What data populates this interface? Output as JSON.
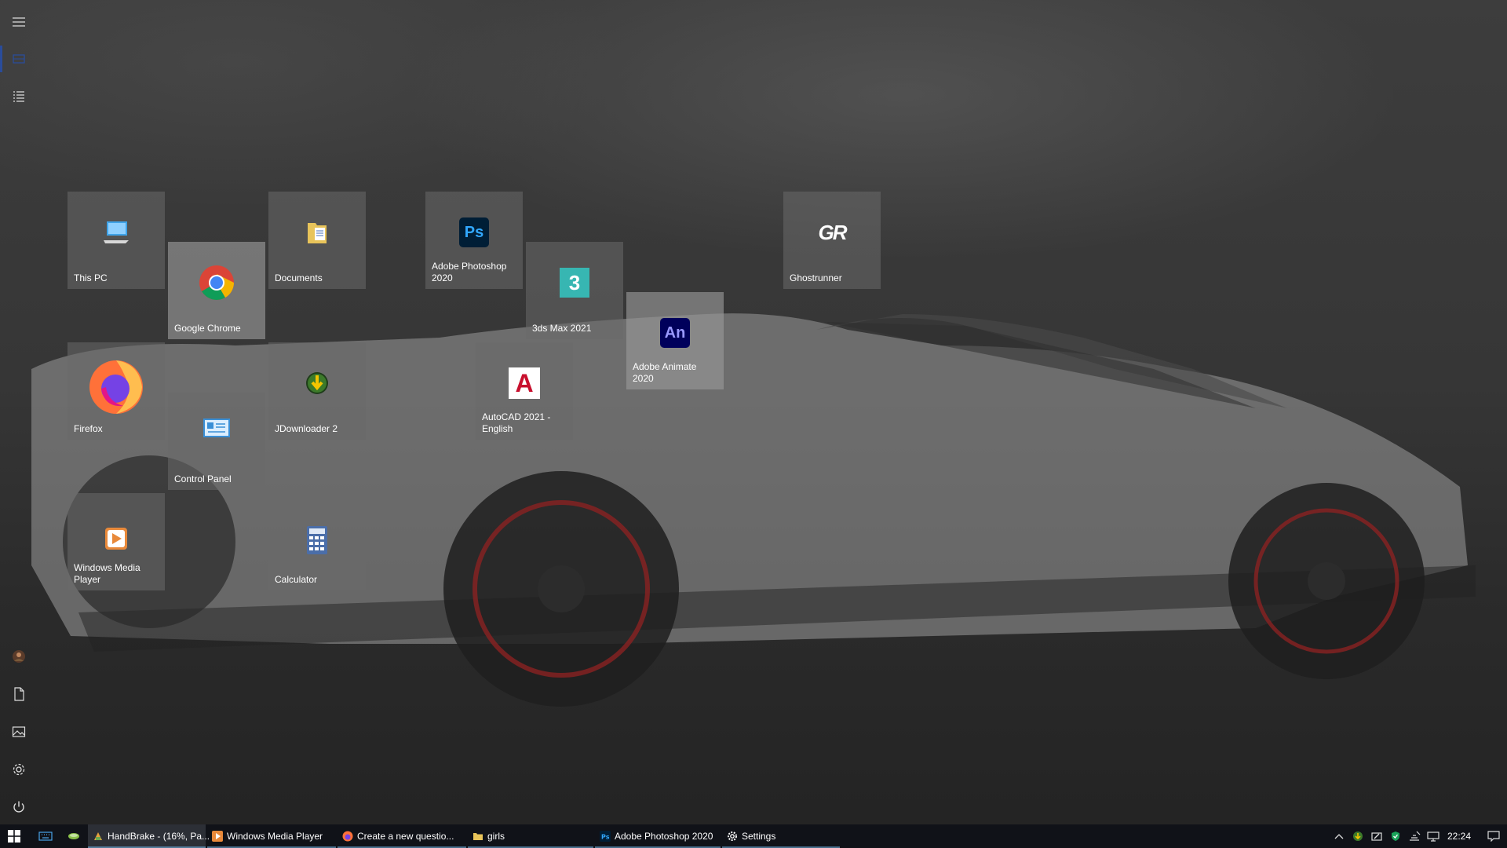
{
  "desktop": {
    "tiles": [
      {
        "label": "This PC"
      },
      {
        "label": "Google Chrome"
      },
      {
        "label": "Documents"
      },
      {
        "label": "Adobe Photoshop 2020"
      },
      {
        "label": "3ds Max 2021"
      },
      {
        "label": "Adobe Animate 2020"
      },
      {
        "label": "Ghostrunner"
      },
      {
        "label": "Firefox"
      },
      {
        "label": "JDownloader 2"
      },
      {
        "label": "Control Panel"
      },
      {
        "label": "AutoCAD 2021 - English"
      },
      {
        "label": "Windows Media Player"
      },
      {
        "label": "Calculator"
      }
    ],
    "tile_glyphs": {
      "photoshop": "Ps",
      "max": "3",
      "animate": "An",
      "autocad": "A",
      "ghostrunner": "GR"
    }
  },
  "rail": {
    "items": [
      "menu-icon",
      "tiles-icon",
      "list-icon",
      "avatar",
      "document-icon",
      "pictures-icon",
      "settings-icon",
      "power-icon"
    ]
  },
  "taskbar": {
    "items": [
      {
        "label": "HandBrake - (16%, Pa..."
      },
      {
        "label": "Windows Media Player"
      },
      {
        "label": "Create a new questio..."
      },
      {
        "label": "girls"
      },
      {
        "label": "Adobe Photoshop 2020"
      },
      {
        "label": "Settings"
      }
    ],
    "clock": "22:24"
  },
  "colors": {
    "accent": "#76b9ed",
    "taskbar": "#101218",
    "tile": "#696969"
  }
}
